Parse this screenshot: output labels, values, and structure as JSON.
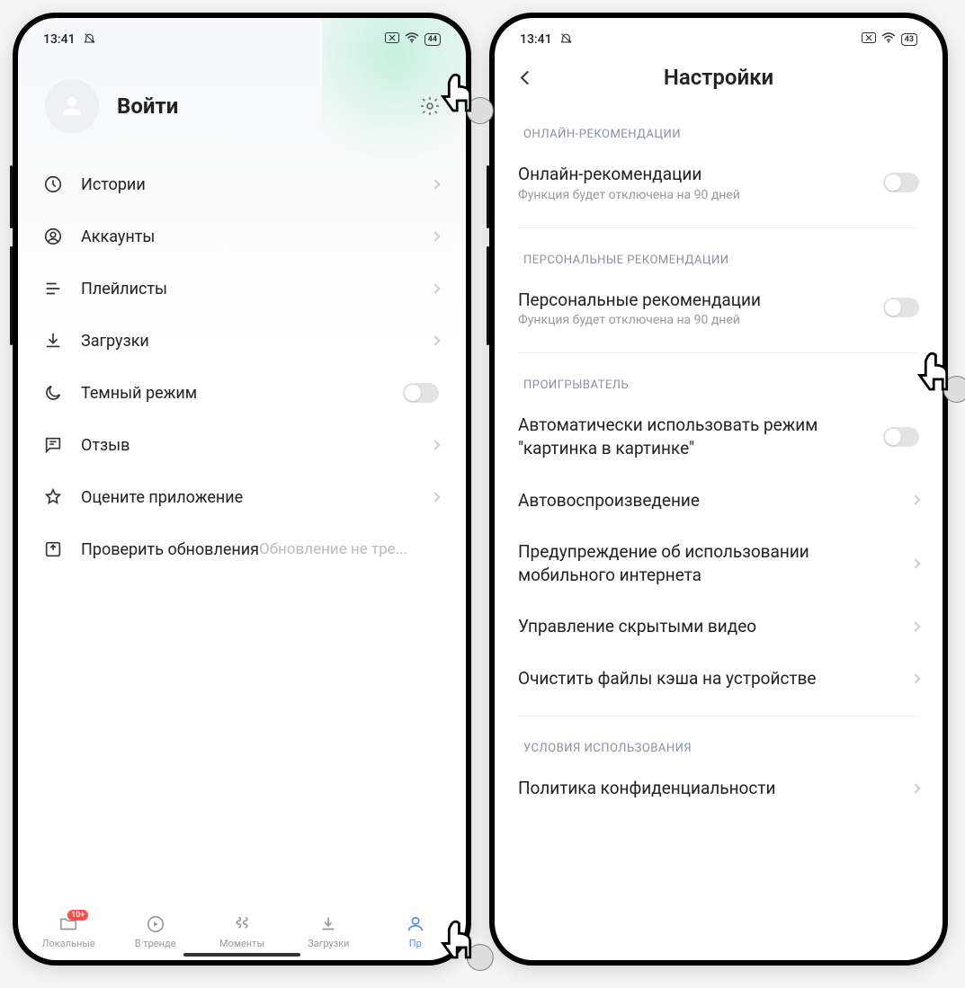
{
  "status": {
    "time": "13:41",
    "battery": "44",
    "battery2": "43"
  },
  "left": {
    "login": "Войти",
    "menu": [
      {
        "key": "history",
        "label": "Истории"
      },
      {
        "key": "accounts",
        "label": "Аккаунты"
      },
      {
        "key": "playlists",
        "label": "Плейлисты"
      },
      {
        "key": "downloads",
        "label": "Загрузки"
      },
      {
        "key": "darkmode",
        "label": "Темный режим"
      },
      {
        "key": "feedback",
        "label": "Отзыв"
      },
      {
        "key": "rate",
        "label": "Оцените приложение"
      },
      {
        "key": "update",
        "label": "Проверить обновления",
        "sub": "Обновление не тре..."
      }
    ],
    "nav": {
      "local": "Локальные",
      "trending": "В тренде",
      "moments": "Моменты",
      "downloads": "Загрузки",
      "profile": "Пр",
      "badge": "10+"
    }
  },
  "right": {
    "title": "Настройки",
    "sections": {
      "online_header": "ОНЛАЙН-РЕКОМЕНДАЦИИ",
      "online_title": "Онлайн-рекомендации",
      "online_sub": "Функция будет отключена на 90 дней",
      "personal_header": "ПЕРСОНАЛЬНЫЕ РЕКОМЕНДАЦИИ",
      "personal_title": "Персональные рекомендации",
      "personal_sub": "Функция будет отключена на 90 дней",
      "player_header": "ПРОИГРЫВАТЕЛЬ",
      "pip": "Автоматически использовать режим \"картинка в картинке\"",
      "autoplay": "Автовоспроизведение",
      "mobile_warn": "Предупреждение об использовании мобильного интернета",
      "hidden": "Управление скрытыми видео",
      "cache": "Очистить файлы кэша на устройстве",
      "terms_header": "УСЛОВИЯ ИСПОЛЬЗОВАНИЯ",
      "privacy": "Политика конфиденциальности"
    }
  }
}
